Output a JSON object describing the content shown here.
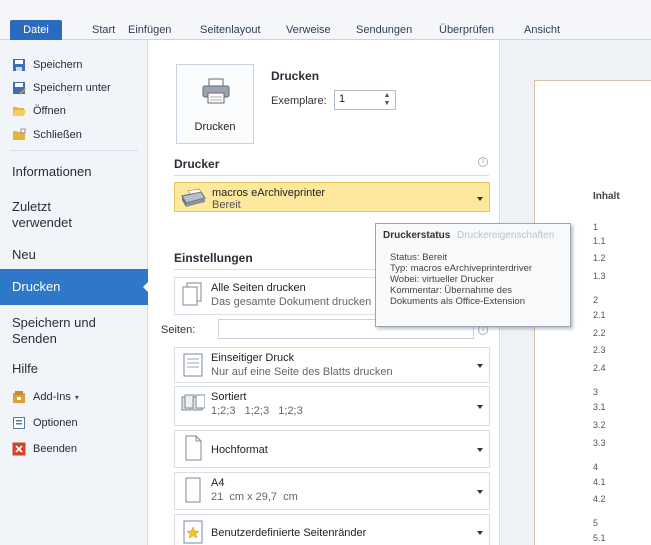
{
  "ribbon": {
    "tabs": [
      "Datei",
      "Start",
      "Einfügen",
      "Seitenlayout",
      "Verweise",
      "Sendungen",
      "Überprüfen",
      "Ansicht"
    ]
  },
  "nav": {
    "save": "Speichern",
    "save_as": "Speichern unter",
    "open": "Öffnen",
    "close": "Schließen",
    "info": "Informationen",
    "recent": "Zuletzt verwendet",
    "new": "Neu",
    "print": "Drucken",
    "save_send": "Speichern und Senden",
    "help": "Hilfe",
    "addins": "Add-Ins",
    "options": "Optionen",
    "exit": "Beenden"
  },
  "print": {
    "button_label": "Drucken",
    "heading": "Drucken",
    "copies_label": "Exemplare:",
    "copies_value": "1"
  },
  "printer": {
    "heading": "Drucker",
    "name": "macros eArchiveprinter",
    "status": "Bereit",
    "properties_link": "Druckereigenschaften"
  },
  "tooltip": {
    "title": "Druckerstatus",
    "lines": [
      "Status: Bereit",
      "Typ: macros eArchiveprinterdriver",
      "Wobei: virtueller Drucker",
      "Kommentar: Übernahme des",
      "Dokuments als Office-Extension"
    ]
  },
  "settings": {
    "heading": "Einstellungen",
    "pages_label": "Seiten:",
    "all_pages_title": "Alle Seiten drucken",
    "all_pages_desc": "Das gesamte Dokument drucken",
    "sided_title": "Einseitiger Druck",
    "sided_desc": "Nur auf eine Seite des Blatts drucken",
    "collated_title": "Sortiert",
    "collated_desc": "1;2;3   1;2;3   1;2;3",
    "orientation": "Hochformat",
    "paper_title": "A4",
    "paper_desc": "21  cm x 29,7  cm",
    "margins": "Benutzerdefinierte Seitenränder"
  },
  "preview": {
    "toc_heading": "Inhalt",
    "toc_items": [
      "1",
      "1.1",
      "1.2",
      "1.3",
      "2",
      "2.1",
      "2.2",
      "2.3",
      "2.4",
      "3",
      "3.1",
      "3.2",
      "3.3",
      "4",
      "4.1",
      "4.2",
      "5",
      "5.1"
    ]
  }
}
